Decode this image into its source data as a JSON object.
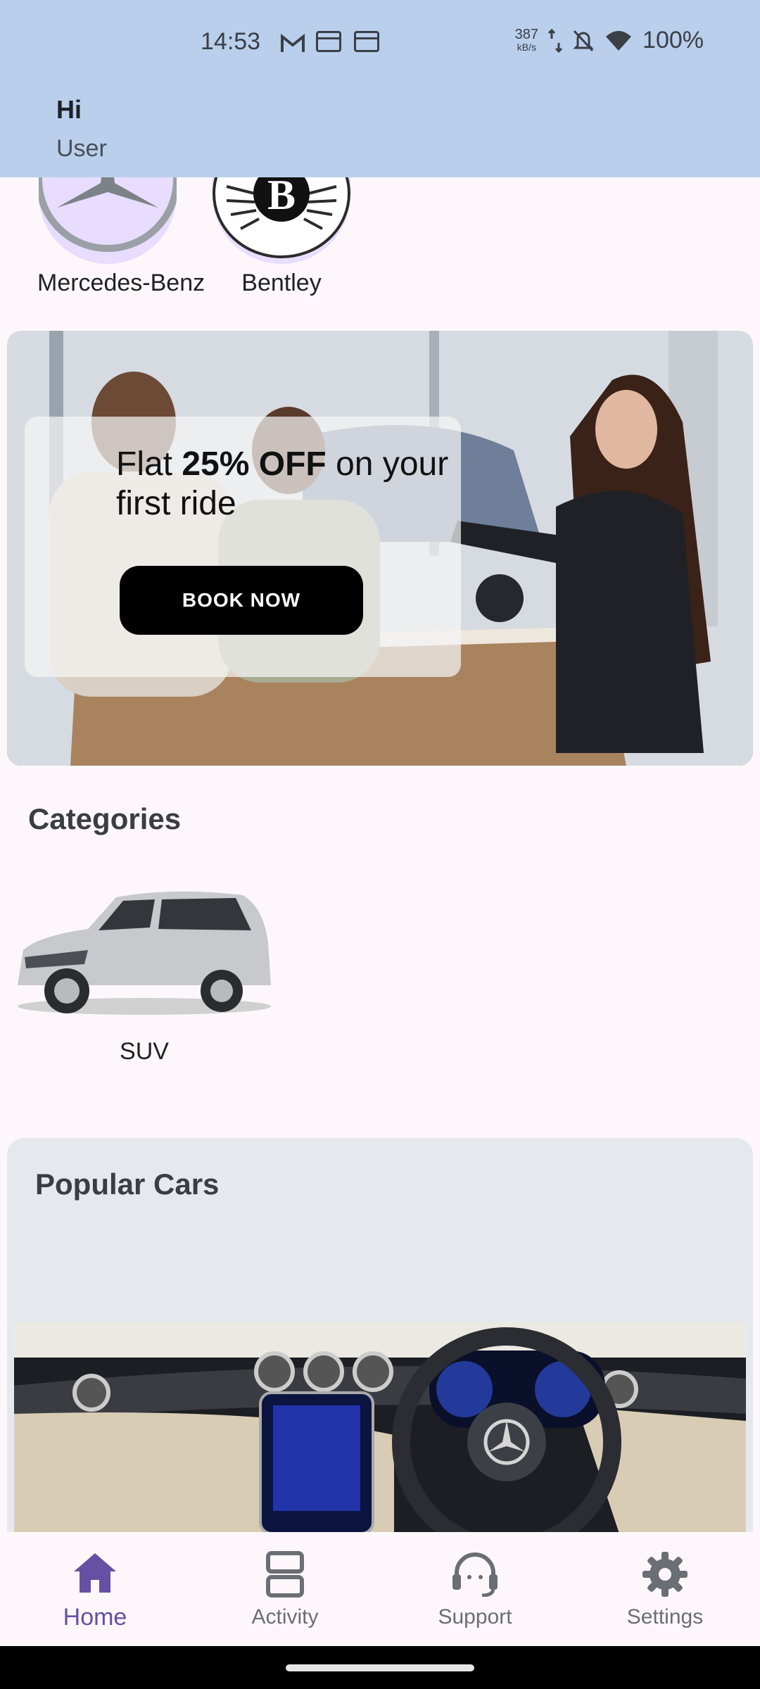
{
  "status": {
    "time": "14:53",
    "speed_value": "387",
    "speed_unit": "kB/s",
    "battery": "100%"
  },
  "header": {
    "greeting": "Hi",
    "username": "User"
  },
  "brands": [
    {
      "label": "Mercedes-Benz"
    },
    {
      "label": "Bentley"
    }
  ],
  "promo": {
    "text_prefix": "Flat ",
    "text_bold": "25% OFF",
    "text_suffix": " on your first ride",
    "button_label": "BOOK NOW"
  },
  "categories": {
    "title": "Categories",
    "items": [
      {
        "label": "SUV"
      }
    ]
  },
  "popular": {
    "title": "Popular Cars"
  },
  "nav": {
    "items": [
      {
        "label": "Home",
        "icon": "home-icon",
        "active": true
      },
      {
        "label": "Activity",
        "icon": "activity-icon"
      },
      {
        "label": "Support",
        "icon": "support-icon"
      },
      {
        "label": "Settings",
        "icon": "settings-icon"
      }
    ]
  },
  "colors": {
    "header_bg": "#b9cfec",
    "accent": "#6650a4",
    "page_bg": "#fdf7fb",
    "button_bg": "#000000"
  }
}
